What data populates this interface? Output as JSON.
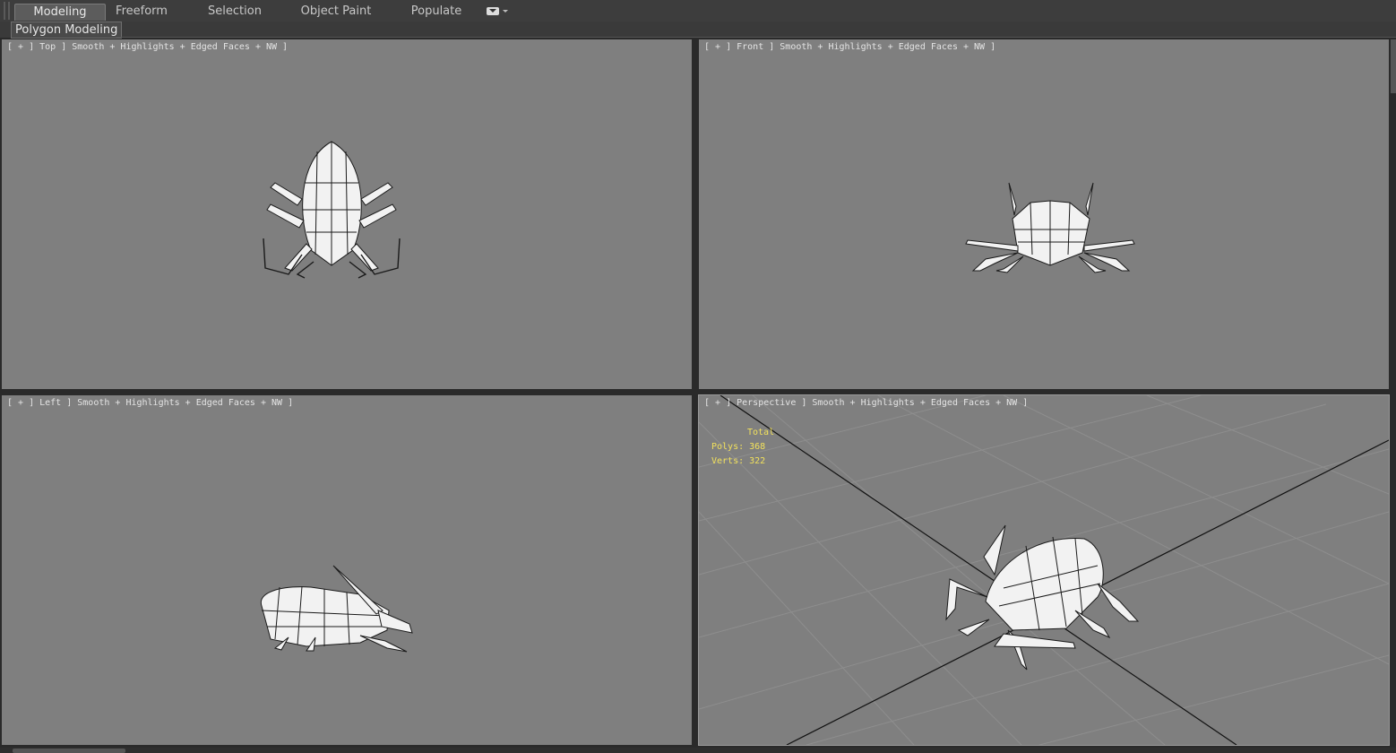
{
  "ribbon": {
    "tabs": [
      {
        "label": "Modeling",
        "active": true
      },
      {
        "label": "Freeform",
        "active": false
      },
      {
        "label": "Selection",
        "active": false
      },
      {
        "label": "Object Paint",
        "active": false
      },
      {
        "label": "Populate",
        "active": false
      }
    ],
    "sub_tab": "Polygon Modeling"
  },
  "viewports": {
    "top": {
      "label": "[ + ] Top ] Smooth + Highlights + Edged Faces + NW ]"
    },
    "front": {
      "label": "[ + ] Front ] Smooth + Highlights + Edged Faces + NW ]"
    },
    "left": {
      "label": "[ + ] Left ] Smooth + Highlights + Edged Faces + NW ]"
    },
    "perspective": {
      "label": "[ + ] Perspective ] Smooth + Highlights + Edged Faces + NW ]",
      "stats": {
        "header": "Total",
        "polys": "Polys: 368",
        "verts": "Verts: 322"
      }
    }
  },
  "colors": {
    "viewport_bg": "#7f7f7f",
    "stats_text": "#f2e15c",
    "ui_bg": "#3d3d3d"
  }
}
